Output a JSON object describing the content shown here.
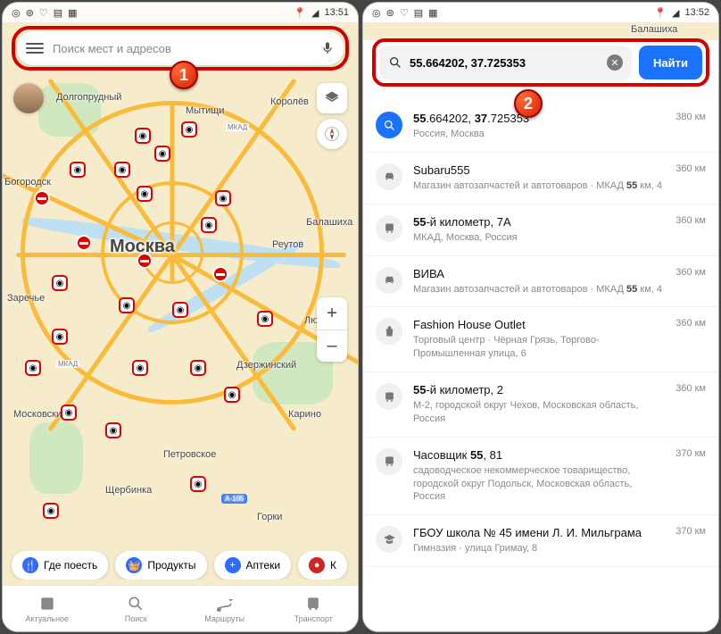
{
  "status": {
    "time_left": "13:51",
    "time_right": "13:52"
  },
  "left": {
    "search_placeholder": "Поиск мест и адресов",
    "city_main": "Москва",
    "labels": [
      "Долгопрудный",
      "Мытищи",
      "Королёв",
      "Богородск",
      "Реутов",
      "Балашиха",
      "Люберцы",
      "Дзержинский",
      "Карино",
      "Московский",
      "Петровское",
      "Щербинка",
      "Горки",
      "А-105",
      "Заречье",
      "МКАД",
      "МКАД"
    ],
    "zoom_in": "+",
    "zoom_out": "–",
    "chips": [
      {
        "icon_color": "#2f6bff",
        "icon": "🍴",
        "label": "Где поесть"
      },
      {
        "icon_color": "#2f6bff",
        "icon": "🧺",
        "label": "Продукты"
      },
      {
        "icon_color": "#2f6bff",
        "icon": "+",
        "label": "Аптеки"
      },
      {
        "icon_color": "#d02525",
        "icon": "●",
        "label": "К"
      }
    ],
    "tabs": [
      {
        "label": "Актуальное"
      },
      {
        "label": "Поиск"
      },
      {
        "label": "Маршруты"
      },
      {
        "label": "Транспорт"
      }
    ]
  },
  "right": {
    "strip_label": "Балашиха",
    "search_value": "55.664202, 37.725353",
    "find_label": "Найти",
    "results": [
      {
        "icon": "search",
        "primary": true,
        "title": "<b>55</b>.664202, <b>37</b>.725353",
        "sub": "Россия, Москва",
        "dist": "380 км"
      },
      {
        "icon": "car",
        "title": "Subaru555",
        "sub": "Магазин автозапчастей и автотоваров · МКАД <b>55</b> км, 4",
        "dist": "360 км"
      },
      {
        "icon": "bus",
        "title": "<b>55</b>-й километр, 7А",
        "sub": "МКАД, Москва, Россия",
        "dist": "360 км"
      },
      {
        "icon": "car",
        "title": "ВИВА",
        "sub": "Магазин автозапчастей и автотоваров · МКАД <b>55</b> км, 4",
        "dist": "360 км"
      },
      {
        "icon": "bag",
        "title": "Fashion House Outlet",
        "sub": "Торговый центр · Чёрная Грязь, Торгово-Промышленная улица, 6",
        "dist": "360 км"
      },
      {
        "icon": "bus",
        "title": "<b>55</b>-й километр, 2",
        "sub": "М-2, городской округ Чехов, Московская область, Россия",
        "dist": "360 км"
      },
      {
        "icon": "bus",
        "title": "Часовщик <b>55</b>, 81",
        "sub": "садоводческое некоммерческое товарищество, городской округ Подольск, Московская область, Россия",
        "dist": "370 км"
      },
      {
        "icon": "grad",
        "title": "ГБОУ школа № 45 имени Л. И. Мильграма",
        "sub": "Гимназия · улица Гримау, 8",
        "dist": "370 км"
      }
    ]
  },
  "badges": {
    "one": "1",
    "two": "2"
  }
}
